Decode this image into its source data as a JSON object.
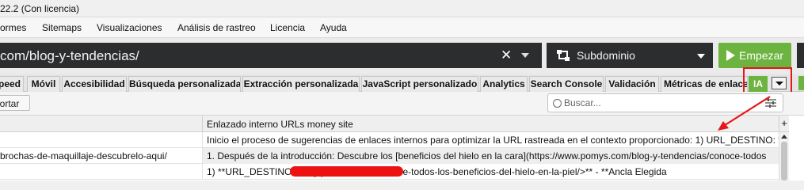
{
  "window": {
    "title": "22.2 (Con licencia)"
  },
  "menu": [
    "ormes",
    "Sitemaps",
    "Visualizaciones",
    "Análisis de rastreo",
    "Licencia",
    "Ayuda"
  ],
  "urlbar": {
    "url": "com/blog-y-tendencias/",
    "mode": "Subdominio",
    "start_label": "Empezar",
    "clear_icon": "close-icon"
  },
  "tabs": [
    "peed",
    "Móvil",
    "Accesibilidad",
    "Búsqueda personalizada",
    "Extracción personalizada",
    "JavaScript personalizado",
    "Analytics",
    "Search Console",
    "Validación",
    "Métricas de enlace"
  ],
  "ia_tab": "IA",
  "toolbar": {
    "export_label": "portar",
    "search_placeholder": "Buscar..."
  },
  "table": {
    "column_header": "Enlazado interno URLs money site",
    "rows": [
      {
        "left": "",
        "text": "Inicio el proceso de sugerencias de enlaces internos para optimizar la URL rastreada en el contexto proporcionado:  1) URL_DESTINO: **"
      },
      {
        "left": "brochas-de-maquillaje-descubrelo-aqui/",
        "text": "1. Después de la introducción:    Descubre los [beneficios del hielo en la cara](https://www.pomys.com/blog-y-tendencias/conoce-todos"
      },
      {
        "left": "",
        "text": "1) **URL_DESTINO:                                          /blog-y-tendencias/conoce-todos-los-beneficios-del-hielo-en-la-piel/>**    - **Ancla Elegida"
      }
    ]
  },
  "colors": {
    "accent_green": "#6cb33f",
    "dark_bar": "#2b2d2f",
    "highlight_red": "#e8151b"
  }
}
